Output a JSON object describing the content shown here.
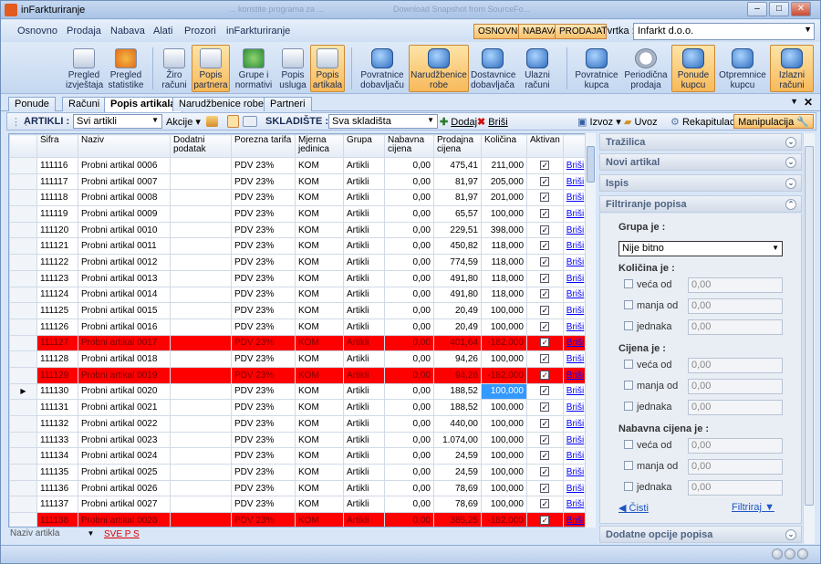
{
  "window": {
    "title": "inFarkturiranje",
    "ghost_tab_1": "... koristite programa za ...",
    "ghost_tab_2": "Download Snapshot from SourceFo...",
    "min": "–",
    "max": "□",
    "close": "✕"
  },
  "menu": {
    "items": [
      "Osnovno",
      "Prodaja",
      "Nabava",
      "Alati",
      "Prozori",
      "inFarkturiranje"
    ],
    "pills": [
      "OSNOVNO",
      "NABAVA",
      "PRODAJA"
    ],
    "tvrtka_label": "Tvrtka :",
    "tvrtka_value": "Infarkt d.o.o."
  },
  "ribbon": [
    {
      "line1": "Pregled",
      "line2": "izvještaja",
      "icon": "report-icon"
    },
    {
      "line1": "Pregled",
      "line2": "statistike",
      "icon": "chart-icon"
    },
    {
      "line1": "Žiro",
      "line2": "računi",
      "icon": "bank-icon"
    },
    {
      "line1": "Popis",
      "line2": "partnera",
      "icon": "partners-icon"
    },
    {
      "line1": "Grupe i",
      "line2": "normativi",
      "icon": "groups-icon"
    },
    {
      "line1": "Popis",
      "line2": "usluga",
      "icon": "services-icon"
    },
    {
      "line1": "Popis",
      "line2": "artikala",
      "icon": "items-icon"
    },
    {
      "line1": "Povratnice",
      "line2": "dobavljaču",
      "icon": "return-supplier-icon"
    },
    {
      "line1": "Narudžbenice",
      "line2": "robe",
      "icon": "purchase-order-icon"
    },
    {
      "line1": "Dostavnice",
      "line2": "dobavljača",
      "icon": "delivery-supplier-icon"
    },
    {
      "line1": "Ulazni",
      "line2": "računi",
      "icon": "incoming-invoice-icon"
    },
    {
      "line1": "Povratnice",
      "line2": "kupca",
      "icon": "return-customer-icon"
    },
    {
      "line1": "Periodična",
      "line2": "prodaja",
      "icon": "clock-icon"
    },
    {
      "line1": "Ponude",
      "line2": "kupcu",
      "icon": "offer-icon"
    },
    {
      "line1": "Otpremnice",
      "line2": "kupcu",
      "icon": "dispatch-icon"
    },
    {
      "line1": "Izlazni",
      "line2": "računi",
      "icon": "outgoing-invoice-icon"
    }
  ],
  "tabs": [
    "Ponude",
    "Računi",
    "Popis artikala",
    "Narudžbenice robe",
    "Partneri"
  ],
  "toolbar": {
    "artikli_label": "ARTIKLI :",
    "artikli_value": "Svi artikli",
    "akcije": "Akcije",
    "skladiste_label": "SKLADIŠTE :",
    "skladiste_value": "Sva skladišta",
    "dodaj": "Dodaj",
    "brisi": "Briši",
    "izvoz": "Izvoz",
    "uvoz": "Uvoz",
    "rekapitulacija": "Rekapitulacija",
    "manipulacija": "Manipulacija"
  },
  "grid": {
    "columns": [
      "Šifra",
      "Naziv",
      "Dodatni podatak",
      "Porezna tarifa",
      "Mjerna jedinica",
      "Grupa",
      "Nabavna cijena",
      "Prodajna cijena",
      "Količina",
      "Aktivan",
      ""
    ],
    "rows": [
      {
        "sifra": "111116",
        "naziv": "Probni artikal 0006",
        "dodatni": "",
        "porez": "PDV 23%",
        "mj": "KOM",
        "grupa": "Artikli",
        "nabavna": "0,00",
        "prodajna": "475,41",
        "kolicina": "211,000",
        "red": false
      },
      {
        "sifra": "111117",
        "naziv": "Probni artikal 0007",
        "dodatni": "",
        "porez": "PDV 23%",
        "mj": "KOM",
        "grupa": "Artikli",
        "nabavna": "0,00",
        "prodajna": "81,97",
        "kolicina": "205,000",
        "red": false
      },
      {
        "sifra": "111118",
        "naziv": "Probni artikal 0008",
        "dodatni": "",
        "porez": "PDV 23%",
        "mj": "KOM",
        "grupa": "Artikli",
        "nabavna": "0,00",
        "prodajna": "81,97",
        "kolicina": "201,000",
        "red": false
      },
      {
        "sifra": "111119",
        "naziv": "Probni artikal 0009",
        "dodatni": "",
        "porez": "PDV 23%",
        "mj": "KOM",
        "grupa": "Artikli",
        "nabavna": "0,00",
        "prodajna": "65,57",
        "kolicina": "100,000",
        "red": false
      },
      {
        "sifra": "111120",
        "naziv": "Probni artikal 0010",
        "dodatni": "",
        "porez": "PDV 23%",
        "mj": "KOM",
        "grupa": "Artikli",
        "nabavna": "0,00",
        "prodajna": "229,51",
        "kolicina": "398,000",
        "red": false
      },
      {
        "sifra": "111121",
        "naziv": "Probni artikal 0011",
        "dodatni": "",
        "porez": "PDV 23%",
        "mj": "KOM",
        "grupa": "Artikli",
        "nabavna": "0,00",
        "prodajna": "450,82",
        "kolicina": "118,000",
        "red": false
      },
      {
        "sifra": "111122",
        "naziv": "Probni artikal 0012",
        "dodatni": "",
        "porez": "PDV 23%",
        "mj": "KOM",
        "grupa": "Artikli",
        "nabavna": "0,00",
        "prodajna": "774,59",
        "kolicina": "118,000",
        "red": false
      },
      {
        "sifra": "111123",
        "naziv": "Probni artikal 0013",
        "dodatni": "",
        "porez": "PDV 23%",
        "mj": "KOM",
        "grupa": "Artikli",
        "nabavna": "0,00",
        "prodajna": "491,80",
        "kolicina": "118,000",
        "red": false
      },
      {
        "sifra": "111124",
        "naziv": "Probni artikal 0014",
        "dodatni": "",
        "porez": "PDV 23%",
        "mj": "KOM",
        "grupa": "Artikli",
        "nabavna": "0,00",
        "prodajna": "491,80",
        "kolicina": "118,000",
        "red": false
      },
      {
        "sifra": "111125",
        "naziv": "Probni artikal 0015",
        "dodatni": "",
        "porez": "PDV 23%",
        "mj": "KOM",
        "grupa": "Artikli",
        "nabavna": "0,00",
        "prodajna": "20,49",
        "kolicina": "100,000",
        "red": false
      },
      {
        "sifra": "111126",
        "naziv": "Probni artikal 0016",
        "dodatni": "",
        "porez": "PDV 23%",
        "mj": "KOM",
        "grupa": "Artikli",
        "nabavna": "0,00",
        "prodajna": "20,49",
        "kolicina": "100,000",
        "red": false
      },
      {
        "sifra": "111127",
        "naziv": "Probni artikal 0017",
        "dodatni": "",
        "porez": "PDV 23%",
        "mj": "KOM",
        "grupa": "Artikli",
        "nabavna": "0,00",
        "prodajna": "401,64",
        "kolicina": "-182,000",
        "red": true
      },
      {
        "sifra": "111128",
        "naziv": "Probni artikal 0018",
        "dodatni": "",
        "porez": "PDV 23%",
        "mj": "KOM",
        "grupa": "Artikli",
        "nabavna": "0,00",
        "prodajna": "94,26",
        "kolicina": "100,000",
        "red": false
      },
      {
        "sifra": "111129",
        "naziv": "Probni artikal 0019",
        "dodatni": "",
        "porez": "PDV 23%",
        "mj": "KOM",
        "grupa": "Artikli",
        "nabavna": "0,00",
        "prodajna": "94,26",
        "kolicina": "-182,000",
        "red": true
      },
      {
        "sifra": "111130",
        "naziv": "Probni artikal 0020",
        "dodatni": "",
        "porez": "PDV 23%",
        "mj": "KOM",
        "grupa": "Artikli",
        "nabavna": "0,00",
        "prodajna": "188,52",
        "kolicina": "100,000",
        "red": false,
        "current": true
      },
      {
        "sifra": "111131",
        "naziv": "Probni artikal 0021",
        "dodatni": "",
        "porez": "PDV 23%",
        "mj": "KOM",
        "grupa": "Artikli",
        "nabavna": "0,00",
        "prodajna": "188,52",
        "kolicina": "100,000",
        "red": false
      },
      {
        "sifra": "111132",
        "naziv": "Probni artikal 0022",
        "dodatni": "",
        "porez": "PDV 23%",
        "mj": "KOM",
        "grupa": "Artikli",
        "nabavna": "0,00",
        "prodajna": "440,00",
        "kolicina": "100,000",
        "red": false
      },
      {
        "sifra": "111133",
        "naziv": "Probni artikal 0023",
        "dodatni": "",
        "porez": "PDV 23%",
        "mj": "KOM",
        "grupa": "Artikli",
        "nabavna": "0,00",
        "prodajna": "1.074,00",
        "kolicina": "100,000",
        "red": false
      },
      {
        "sifra": "111134",
        "naziv": "Probni artikal 0024",
        "dodatni": "",
        "porez": "PDV 23%",
        "mj": "KOM",
        "grupa": "Artikli",
        "nabavna": "0,00",
        "prodajna": "24,59",
        "kolicina": "100,000",
        "red": false
      },
      {
        "sifra": "111135",
        "naziv": "Probni artikal 0025",
        "dodatni": "",
        "porez": "PDV 23%",
        "mj": "KOM",
        "grupa": "Artikli",
        "nabavna": "0,00",
        "prodajna": "24,59",
        "kolicina": "100,000",
        "red": false
      },
      {
        "sifra": "111136",
        "naziv": "Probni artikal 0026",
        "dodatni": "",
        "porez": "PDV 23%",
        "mj": "KOM",
        "grupa": "Artikli",
        "nabavna": "0,00",
        "prodajna": "78,69",
        "kolicina": "100,000",
        "red": false
      },
      {
        "sifra": "111137",
        "naziv": "Probni artikal 0027",
        "dodatni": "",
        "porez": "PDV 23%",
        "mj": "KOM",
        "grupa": "Artikli",
        "nabavna": "0,00",
        "prodajna": "78,69",
        "kolicina": "100,000",
        "red": false
      },
      {
        "sifra": "111138",
        "naziv": "Probni artikal 0028",
        "dodatni": "",
        "porez": "PDV 23%",
        "mj": "KOM",
        "grupa": "Artikli",
        "nabavna": "0,00",
        "prodajna": "385,25",
        "kolicina": "-182,000",
        "red": true
      }
    ],
    "aktivan_mark": "✓",
    "brisi_label": "Briši",
    "row_marker": "▶"
  },
  "bottom": {
    "naziv_select": "Naziv artikla",
    "letters": "SVE P S"
  },
  "panel": {
    "sections": [
      "Tražilica",
      "Novi artikal",
      "Ispis",
      "Filtriranje popisa",
      "Dodatne opcije popisa"
    ],
    "grupa_label": "Grupa je :",
    "grupa_value": "Nije bitno",
    "kolicina_label": "Količina je :",
    "cijena_label": "Cijena je :",
    "nabavna_label": "Nabavna cijena je :",
    "options": [
      "veća od",
      "manja od",
      "jednaka"
    ],
    "zero": "0,00",
    "cisti": "Čisti",
    "filtriraj": "Filtriraj"
  },
  "colors": {
    "red_row": "#ff0000",
    "selected_cell": "#3399ff",
    "accent_orange": "#f7b95a"
  }
}
